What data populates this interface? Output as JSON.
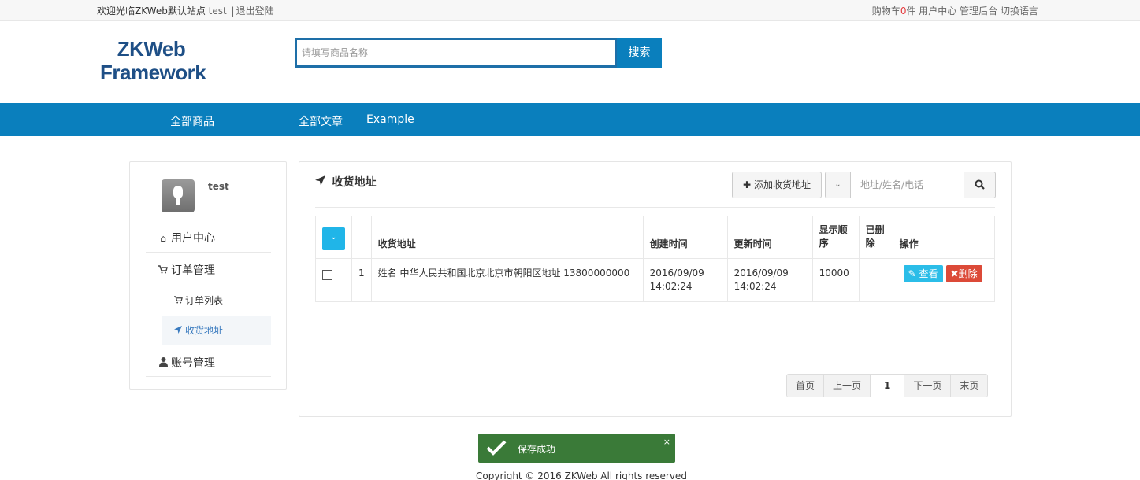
{
  "topbar": {
    "welcome": "欢迎光临ZKWeb默认站点",
    "username": "test",
    "separator": "|",
    "logout": "退出登陆",
    "cart_prefix": "购物车",
    "cart_count": "0",
    "cart_suffix": "件",
    "user_center": "用户中心",
    "admin": "管理后台",
    "switch_lang": "切换语言"
  },
  "header": {
    "logo_line1": "ZKWeb",
    "logo_line2": "Framework",
    "search_placeholder": "请填写商品名称",
    "search_button": "搜索"
  },
  "nav": {
    "items": [
      {
        "label": "全部商品"
      },
      {
        "label": "全部文章"
      },
      {
        "label": "Example"
      }
    ]
  },
  "sidebar": {
    "username": "test",
    "items": [
      {
        "label": "用户中心",
        "icon": "home-icon"
      },
      {
        "label": "订单管理",
        "icon": "cart-icon"
      },
      {
        "label": "订单列表",
        "icon": "cart-icon"
      },
      {
        "label": "收货地址",
        "icon": "location-arrow-icon",
        "active": true
      },
      {
        "label": "账号管理",
        "icon": "user-icon"
      }
    ]
  },
  "main": {
    "title": "收货地址",
    "add_button": "添加收货地址",
    "filter_placeholder": "地址/姓名/电话",
    "table": {
      "headers": [
        "",
        "",
        "收货地址",
        "创建时间",
        "更新时间",
        "显示顺序",
        "已删除",
        "操作"
      ],
      "rows": [
        {
          "index": "1",
          "address": "姓名 中华人民共和国北京北京市朝阳区地址 13800000000",
          "created_date": "2016/09/09",
          "created_time": "14:02:24",
          "updated_date": "2016/09/09",
          "updated_time": "14:02:24",
          "order": "10000",
          "deleted": "",
          "view_label": "查看",
          "delete_label": "删除"
        }
      ]
    },
    "pagination": {
      "first": "首页",
      "prev": "上一页",
      "current": "1",
      "next": "下一页",
      "last": "末页"
    }
  },
  "toast": {
    "message": "保存成功",
    "close": "×"
  },
  "footer": {
    "copyright": "Copyright © 2016 ZKWeb All rights reserved"
  },
  "colors": {
    "brand_blue": "#0a7fbd",
    "logo_blue": "#1e4f86",
    "info": "#2bbde8",
    "danger": "#dc4a38",
    "success_toast": "#3a7a38",
    "cart_count": "#e4393c"
  }
}
